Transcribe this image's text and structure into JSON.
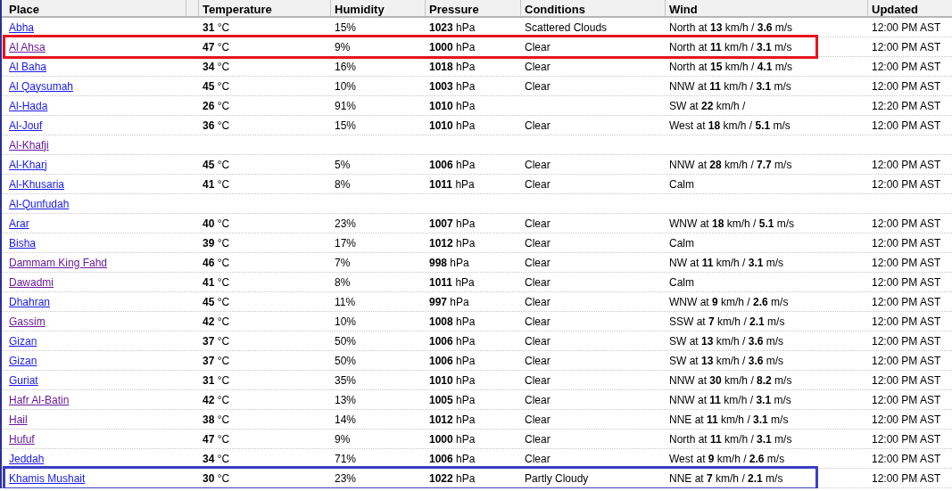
{
  "table": {
    "columns": [
      "Place",
      "",
      "Temperature",
      "Humidity",
      "Pressure",
      "Conditions",
      "Wind",
      "Updated"
    ],
    "rows": [
      {
        "place": "Abha",
        "visited": false,
        "temperature": "**31** °C",
        "humidity": "15%",
        "pressure": "**1023** hPa",
        "conditions": "Scattered Clouds",
        "wind": "North at **13** km/h / **3.6** m/s",
        "updated": "12:00 PM AST"
      },
      {
        "place": "Al Ahsa",
        "visited": true,
        "temperature": "**47** °C",
        "humidity": "9%",
        "pressure": "**1000** hPa",
        "conditions": "Clear",
        "wind": "North at **11** km/h / **3.1** m/s",
        "updated": "12:00 PM AST",
        "color": "#e8141c"
      },
      {
        "place": "Al Baha",
        "visited": false,
        "temperature": "**34** °C",
        "humidity": "16%",
        "pressure": "**1018** hPa",
        "conditions": "Clear",
        "wind": "North at **15** km/h / **4.1** m/s",
        "updated": "12:00 PM AST"
      },
      {
        "place": "Al Qaysumah",
        "visited": false,
        "temperature": "**45** °C",
        "humidity": "10%",
        "pressure": "**1003** hPa",
        "conditions": "Clear",
        "wind": "NNW at **11** km/h / **3.1** m/s",
        "updated": "12:00 PM AST"
      },
      {
        "place": "Al-Hada",
        "visited": false,
        "temperature": "**26** °C",
        "humidity": "91%",
        "pressure": "**1010** hPa",
        "wind": "SW at **22** km/h /",
        "updated": "12:20 PM AST"
      },
      {
        "place": "Al-Jouf",
        "visited": false,
        "temperature": "**36** °C",
        "humidity": "15%",
        "pressure": "**1010** hPa",
        "conditions": "Clear",
        "wind": "West at **18** km/h / **5.1** m/s",
        "updated": "12:00 PM AST"
      },
      {
        "place": "Al-Khafji",
        "visited": true
      },
      {
        "place": "Al-Kharj",
        "visited": false,
        "temperature": "**45** °C",
        "humidity": "5%",
        "pressure": "**1006** hPa",
        "conditions": "Clear",
        "wind": "NNW at **28** km/h / **7.7** m/s",
        "updated": "12:00 PM AST"
      },
      {
        "place": "Al-Khusaria",
        "visited": false,
        "temperature": "**41** °C",
        "humidity": "8%",
        "pressure": "**1011** hPa",
        "conditions": "Clear",
        "wind": "Calm",
        "updated": "12:00 PM AST"
      },
      {
        "place": "Al-Qunfudah",
        "visited": false
      },
      {
        "place": "Arar",
        "visited": false,
        "temperature": "**40** °C",
        "humidity": "23%",
        "pressure": "**1007** hPa",
        "conditions": "Clear",
        "wind": "WNW at **18** km/h / **5.1** m/s",
        "updated": "12:00 PM AST"
      },
      {
        "place": "Bisha",
        "visited": false,
        "temperature": "**39** °C",
        "humidity": "17%",
        "pressure": "**1012** hPa",
        "conditions": "Clear",
        "wind": "Calm",
        "updated": "12:00 PM AST"
      },
      {
        "place": "Dammam King Fahd",
        "visited": true,
        "temperature": "**46** °C",
        "humidity": "7%",
        "pressure": "**998** hPa",
        "conditions": "Clear",
        "wind": "NW at **11** km/h / **3.1** m/s",
        "updated": "12:00 PM AST"
      },
      {
        "place": "Dawadmi",
        "visited": true,
        "temperature": "**41** °C",
        "humidity": "8%",
        "pressure": "**1011** hPa",
        "conditions": "Clear",
        "wind": "Calm",
        "updated": "12:00 PM AST"
      },
      {
        "place": "Dhahran",
        "visited": false,
        "temperature": "**45** °C",
        "humidity": "11%",
        "pressure": "**997** hPa",
        "conditions": "Clear",
        "wind": "WNW at **9** km/h / **2.6** m/s",
        "updated": "12:00 PM AST"
      },
      {
        "place": "Gassim",
        "visited": true,
        "temperature": "**42** °C",
        "humidity": "10%",
        "pressure": "**1008** hPa",
        "conditions": "Clear",
        "wind": "SSW at **7** km/h / **2.1** m/s",
        "updated": "12:00 PM AST"
      },
      {
        "place": "Gizan",
        "visited": false,
        "temperature": "**37** °C",
        "humidity": "50%",
        "pressure": "**1006** hPa",
        "conditions": "Clear",
        "wind": "SW at **13** km/h / **3.6** m/s",
        "updated": "12:00 PM AST"
      },
      {
        "place": "Gizan",
        "visited": false,
        "temperature": "**37** °C",
        "humidity": "50%",
        "pressure": "**1006** hPa",
        "conditions": "Clear",
        "wind": "SW at **13** km/h / **3.6** m/s",
        "updated": "12:00 PM AST"
      },
      {
        "place": "Guriat",
        "visited": false,
        "temperature": "**31** °C",
        "humidity": "35%",
        "pressure": "**1010** hPa",
        "conditions": "Clear",
        "wind": "NNW at **30** km/h / **8.2** m/s",
        "updated": "12:00 PM AST"
      },
      {
        "place": "Hafr Al-Batin",
        "visited": true,
        "temperature": "**42** °C",
        "humidity": "13%",
        "pressure": "**1005** hPa",
        "conditions": "Clear",
        "wind": "NNW at **11** km/h / **3.1** m/s",
        "updated": "12:00 PM AST"
      },
      {
        "place": "Hail",
        "visited": true,
        "temperature": "**38** °C",
        "humidity": "14%",
        "pressure": "**1012** hPa",
        "conditions": "Clear",
        "wind": "NNE at **11** km/h / **3.1** m/s",
        "updated": "12:00 PM AST"
      },
      {
        "place": "Hufuf",
        "visited": true,
        "temperature": "**47** °C",
        "humidity": "9%",
        "pressure": "**1000** hPa",
        "conditions": "Clear",
        "wind": "North at **11** km/h / **3.1** m/s",
        "updated": "12:00 PM AST"
      },
      {
        "place": "Jeddah",
        "visited": false,
        "temperature": "**34** °C",
        "humidity": "71%",
        "pressure": "**1006** hPa",
        "conditions": "Clear",
        "wind": "West at **9** km/h / **2.6** m/s",
        "updated": "12:00 PM AST"
      },
      {
        "place": "Khamis Mushait",
        "visited": false,
        "temperature": "**30** °C",
        "humidity": "23%",
        "pressure": "**1022** hPa",
        "conditions": "Partly Cloudy",
        "wind": "NNE at **7** km/h / **2.1** m/s",
        "updated": "12:00 PM AST",
        "color": "#3b3fc4"
      }
    ]
  }
}
